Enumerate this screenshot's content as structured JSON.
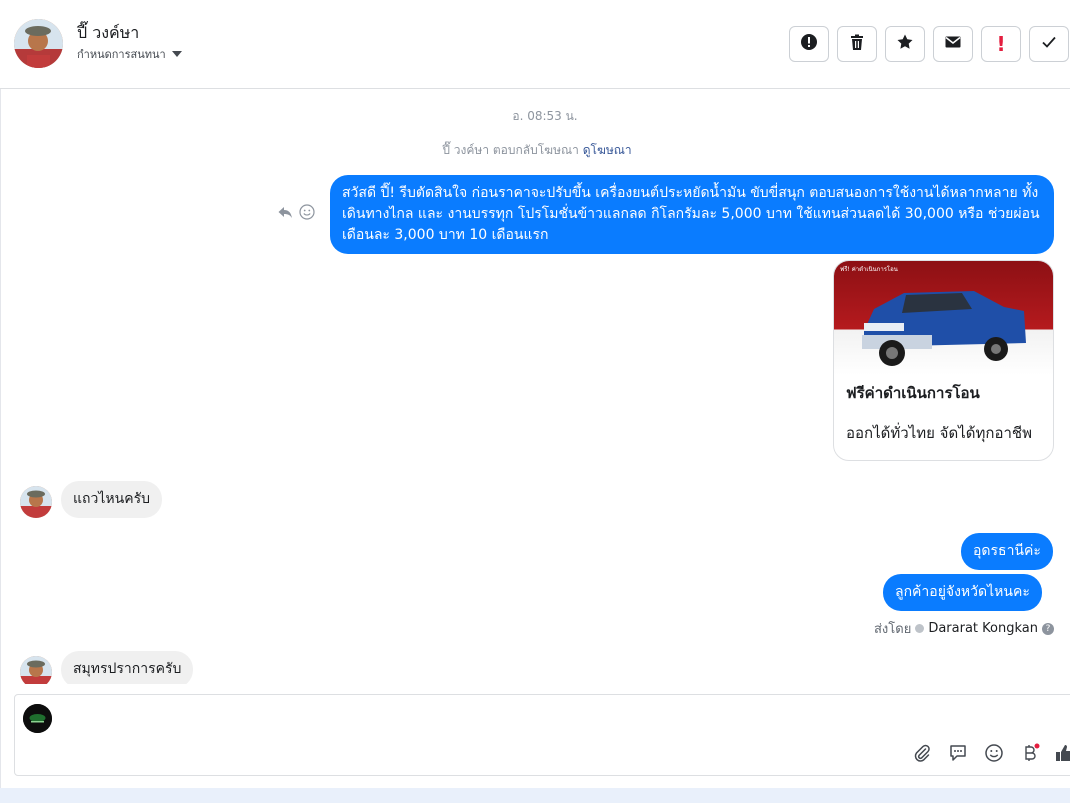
{
  "header": {
    "contact_name": "ปี๊ วงค์ษา",
    "assign_label": "กำหนดการสนทนา",
    "actions": [
      {
        "name": "report-icon"
      },
      {
        "name": "trash-icon"
      },
      {
        "name": "star-icon"
      },
      {
        "name": "mail-icon"
      },
      {
        "name": "important-icon",
        "label": "!"
      },
      {
        "name": "check-icon"
      }
    ]
  },
  "thread": {
    "timestamp": "อ. 08:53 น.",
    "ad_reply_text": "ปี๊ วงค์ษา ตอบกลับโฆษณา",
    "ad_reply_link": "ดูโฆษณา",
    "messages": [
      {
        "dir": "out",
        "text": "สวัสดี ปี๊!  รีบตัดสินใจ ก่อนราคาจะปรับขึ้น เครื่องยนต์ประหยัดน้ำมัน ขับขี่สนุก ตอบสนองการใช้งานได้หลากหลาย ทั้งเดินทางไกล และ งานบรรทุก โปรโมชั่นข้าวแลกลด กิโลกรัมละ 5,000 บาท ใช้แทนส่วนลดได้ 30,000 หรือ ช่วยผ่อนเดือนละ 3,000 บาท  10 เดือนแรก"
      },
      {
        "dir": "in",
        "text": "แถวไหนครับ"
      },
      {
        "dir": "out",
        "text": "อุดรธานีค่ะ"
      },
      {
        "dir": "out",
        "text": "ลูกค้าอยู่จังหวัดไหนคะ"
      },
      {
        "dir": "in",
        "text": "สมุทรปราการครับ"
      }
    ],
    "ad_card": {
      "title": "ฟรีค่าดำเนินการโอน",
      "description": "ออกได้ทั่วไทย จัดได้ทุกอาชีพ",
      "image_caption": "ฟรี! ค่าดำเนินการโอน"
    },
    "sent_by_label": "ส่งโดย",
    "sent_by_name": "Dararat Kongkan",
    "help_glyph": "?"
  },
  "composer": {
    "value": "",
    "tools": [
      "paperclip-icon",
      "saved-reply-icon",
      "emoji-icon",
      "baht-icon",
      "like-icon"
    ]
  },
  "colors": {
    "outgoing_bubble": "#0a7cff",
    "incoming_bubble": "#f0f0f0",
    "important_red": "#e41e3f"
  }
}
